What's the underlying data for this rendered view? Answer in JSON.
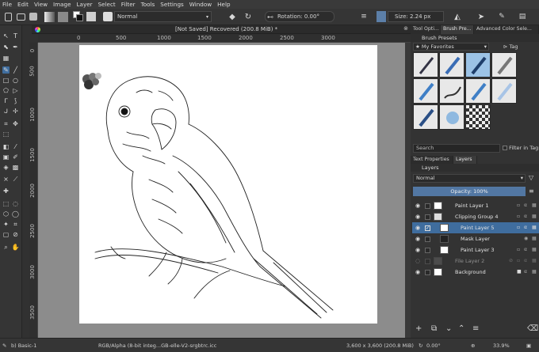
{
  "menu": [
    "File",
    "Edit",
    "View",
    "Image",
    "Layer",
    "Select",
    "Filter",
    "Tools",
    "Settings",
    "Window",
    "Help"
  ],
  "toolbar": {
    "blend_mode": "Normal",
    "rotation": "Rotation: 0.00°",
    "size": "Size: 2.24 px"
  },
  "document_tab": {
    "title": "[Not Saved]  Recovered (200.8 MiB) *"
  },
  "ruler": {
    "top": [
      "0",
      "500",
      "1000",
      "1500",
      "2000",
      "2500",
      "3000"
    ],
    "left": [
      "0",
      "500",
      "1000",
      "1500",
      "2000",
      "2500",
      "3000",
      "3500"
    ]
  },
  "right_panel": {
    "top_tabs": [
      "Tool Opti...",
      "Brush Pre...",
      "Advanced Color Sele..."
    ],
    "brush_presets_title": "Brush Presets",
    "favorites": "My Favorites",
    "tag_label": "Tag",
    "search_placeholder": "Search",
    "filter_in_tag": "Filter in Tag",
    "lower_tabs": [
      "Text Properties",
      "Layers"
    ],
    "layers_title": "Layers",
    "layer_blend_mode": "Normal",
    "opacity": "Opacity:  100%",
    "layers": [
      {
        "name": "Paint Layer 1"
      },
      {
        "name": "Clipping Group 4"
      },
      {
        "name": "Paint Layer 5"
      },
      {
        "name": "Mask Layer"
      },
      {
        "name": "Paint Layer 3"
      },
      {
        "name": "File Layer 2"
      },
      {
        "name": "Background"
      }
    ]
  },
  "status": {
    "brush": "b) Basic-1",
    "color_space": "RGB/Alpha (8-bit integ...GB-elle-V2-srgbtrc.icc",
    "dimensions": "3,600 x 3,600 (200.8 MiB)",
    "rotation": "0.00°",
    "zoom": "33.9%"
  },
  "colors": {
    "accent": "#3f6d9e",
    "canvas_bg": "#8c8c8c",
    "panel": "#333333"
  }
}
